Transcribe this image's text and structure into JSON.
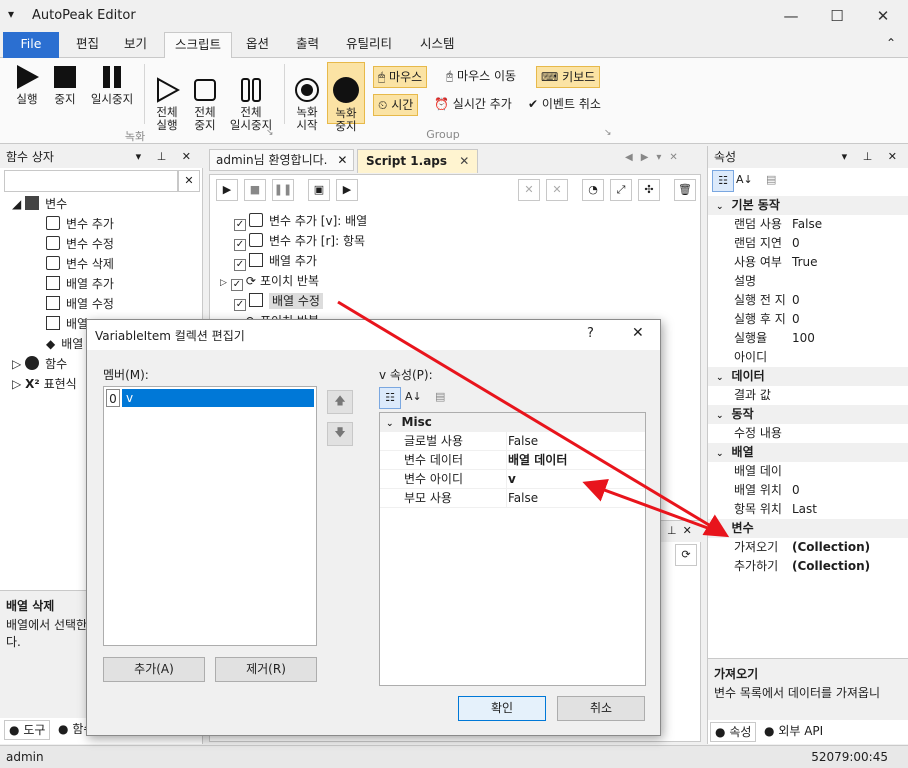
{
  "app": {
    "title": "AutoPeak Editor"
  },
  "menu_tabs": [
    "File",
    "편집",
    "보기",
    "스크립트",
    "옵션",
    "출력",
    "유틸리티",
    "시스템"
  ],
  "ribbon": {
    "run": "실행",
    "stop": "중지",
    "pause": "일시중지",
    "run_all": "전체\n실행",
    "stop_all": "전체\n중지",
    "pause_all": "전체\n일시중지",
    "record_start": "녹화\n시작",
    "record_stop": "녹화\n중지",
    "mouse": "마우스",
    "mouse_move": "마우스 이동",
    "keyboard": "키보드",
    "time": "시간",
    "realtime_add": "실시간 추가",
    "event_cancel": "이벤트 취소",
    "group_record": "녹화",
    "group_group": "Group"
  },
  "left_panel": {
    "title": "함수 상자",
    "search_placeholder": "",
    "tree": {
      "variables": "변수",
      "items": [
        "변수 추가",
        "변수 수정",
        "변수 삭제",
        "배열 추가",
        "배열 수정",
        "배열",
        "배열"
      ],
      "functions": "함수",
      "expressions": "표현식"
    },
    "desc_title": "배열 삭제",
    "desc_text": "배열에서 선택한\n다.",
    "bottom_tabs": [
      "도구",
      "함수"
    ]
  },
  "doc_tabs": [
    {
      "label": "admin님 환영합니다."
    },
    {
      "label": "Script 1.aps"
    }
  ],
  "script_lines": [
    "변수 추가 [v]: 배열",
    "변수 추가 [r]: 항목",
    "배열 추가",
    "포이치 반복",
    "배열 수정",
    "포이치 반복"
  ],
  "properties": {
    "title": "속성",
    "categories": [
      {
        "name": "기본 동작",
        "rows": [
          [
            "랜덤 사용",
            "False"
          ],
          [
            "랜덤 지연",
            "0"
          ],
          [
            "사용 여부",
            "True"
          ],
          [
            "설명",
            ""
          ],
          [
            "실행 전 지",
            "0"
          ],
          [
            "실행 후 지",
            "0"
          ],
          [
            "실행율",
            "100"
          ],
          [
            "아이디",
            ""
          ]
        ]
      },
      {
        "name": "데이터",
        "rows": [
          [
            "결과 값",
            ""
          ]
        ]
      },
      {
        "name": "동작",
        "rows": [
          [
            "수정 내용",
            ""
          ]
        ]
      },
      {
        "name": "배열",
        "rows": [
          [
            "배열 데이",
            ""
          ],
          [
            "배열 위치",
            "0"
          ],
          [
            "항목 위치",
            "Last"
          ]
        ]
      },
      {
        "name": "변수",
        "rows": [
          [
            "가져오기",
            "(Collection)"
          ],
          [
            "추가하기",
            "(Collection)"
          ]
        ]
      }
    ],
    "desc_title": "가져오기",
    "desc_text": "변수 목록에서 데이터를 가져옵니",
    "bottom_tabs": [
      "속성",
      "외부 API"
    ]
  },
  "dialog": {
    "title": "VariableItem 컬렉션 편집기",
    "members_label": "멤버(M):",
    "members": [
      {
        "index": "0",
        "name": "v"
      }
    ],
    "props_label": "v 속성(P):",
    "category": "Misc",
    "rows": [
      {
        "key": "글로벌 사용",
        "value": "False",
        "bold": false
      },
      {
        "key": "변수 데이터",
        "value": "배열 데이터",
        "bold": true
      },
      {
        "key": "변수 아이디",
        "value": "v",
        "bold": true
      },
      {
        "key": "부모 사용",
        "value": "False",
        "bold": false
      }
    ],
    "add_button": "추가(A)",
    "remove_button": "제거(R)",
    "ok_button": "확인",
    "cancel_button": "취소",
    "help_glyph": "?",
    "close_glyph": "✕"
  },
  "status": {
    "user": "admin",
    "time": "52079:00:45"
  },
  "colors": {
    "accent": "#2b6fd1",
    "highlight": "#fbe3a4",
    "arrow": "#e8141c",
    "selection": "#0078d7"
  }
}
